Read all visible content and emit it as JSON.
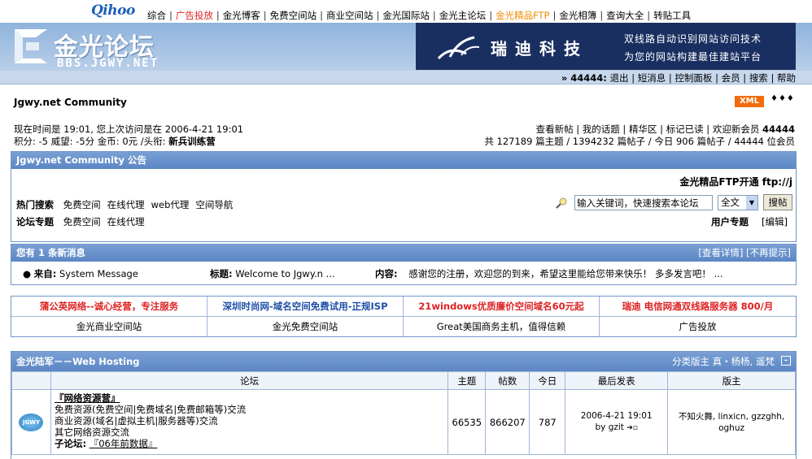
{
  "topnav": {
    "logo": "Qihoo",
    "links": [
      {
        "label": "综合",
        "color": "#000000"
      },
      {
        "label": "广告投放",
        "color": "#dd2222"
      },
      {
        "label": "金光博客",
        "color": "#000000"
      },
      {
        "label": "免费空间站",
        "color": "#000000"
      },
      {
        "label": "商业空间站",
        "color": "#000000"
      },
      {
        "label": "金光国际站",
        "color": "#000000"
      },
      {
        "label": "金光主论坛",
        "color": "#000000"
      },
      {
        "label": "金光精品FTP",
        "color": "#f08a00"
      },
      {
        "label": "金光相簿",
        "color": "#000000"
      },
      {
        "label": "查询大全",
        "color": "#000000"
      },
      {
        "label": "转贴工具",
        "color": "#000000"
      }
    ]
  },
  "header": {
    "logo_cn": "金光论坛",
    "logo_en": "BBS.JGWY.NET",
    "banner": {
      "name": "瑞迪科技",
      "line1": "双线路自动识别网站访问技术",
      "line2": "为您的网站构建最佳建站平台"
    }
  },
  "userbar": {
    "prefix": "» ",
    "user": "44444:",
    "links": [
      "退出",
      "短消息",
      "控制面板",
      "会员",
      "搜索",
      "帮助"
    ]
  },
  "main": {
    "community_title": "Jgwy.net Community",
    "xml_badge": "XML",
    "arrows": "♦♦♦",
    "status": {
      "time_line": "现在时间是 19:01, 您上次访问是在 2006-4-21 19:01",
      "stats_prefix": "积分: -5 威望: -5分 金币: 0元 /头衔: ",
      "rank": "新兵训练营",
      "right_links": "查看新帖 | 我的话题 | 精华区 | 标记已读 | 欢迎新会员 ",
      "newest_member": "44444",
      "totals": "共 127189 篇主题 / 1394232 篇帖子 / 今日 906 篇帖子 / 44444 位会员"
    },
    "notice": {
      "title": "Jgwy.net Community 公告",
      "marquee": "金光精品FTP开通 ftp://j",
      "hot_search_label": "热门搜索",
      "hot_search_links": [
        "免费空间",
        "在线代理",
        "web代理",
        "空间导航"
      ],
      "topics_label": "论坛专题",
      "topic_links": [
        "免费空间",
        "在线代理"
      ],
      "search_input": "输入关键词，快速搜索本论坛",
      "search_select": "全文",
      "search_button": "搜帖",
      "user_topics": "用户专题",
      "edit": "[编辑]"
    },
    "messages": {
      "title": "您有 1 条新消息",
      "view_detail": "[查看详情]",
      "no_remind": "[不再提示]",
      "from_label": "来自:",
      "from": "System Message",
      "subject_label": "标题:",
      "subject": "Welcome to Jgwy.n ...",
      "content_label": "内容:",
      "content": "感谢您的注册，欢迎您的到来，希望这里能给您带来快乐！ 多多发言吧！ ..."
    },
    "ads": {
      "row1": [
        {
          "text": "蒲公英网络--诚心经营，专注服务",
          "color": "#dd2222"
        },
        {
          "text": "深圳时尚网-域名空间免费试用-正规ISP",
          "color": "#1e4fa8"
        },
        {
          "text": "21windows优质廉价空间域名60元起",
          "color": "#dd2222"
        },
        {
          "text": "瑞迪 电信网通双线路服务器 800/月",
          "color": "#dd2222"
        }
      ],
      "row2": [
        "金光商业空间站",
        "金光免费空间站",
        "Great美国商务主机，值得信赖",
        "广告投放"
      ]
    },
    "forum": {
      "section_title": "金光陆军－－Web Hosting",
      "moderators": "分类版主 真・杨杨, 遥梵",
      "columns": [
        "论坛",
        "主题",
        "帖数",
        "今日",
        "最后发表",
        "版主"
      ],
      "rows": [
        {
          "icon_label": "JGWY",
          "name": "『网络资源营』",
          "desc_lines": [
            "免费资源(免费空间|免费域名|免费邮箱等)交流",
            "商业资源(域名|虚拟主机|服务器等)交流",
            "其它网络资源交流"
          ],
          "sub_label": "子论坛:",
          "sub": "『06年前数据』",
          "topics": "66535",
          "posts": "866207",
          "today": "787",
          "last_time": "2006-4-21 19:01",
          "last_by": "by gzit",
          "mods": "不知火舞, linxicn, gzzghh, oghuz"
        }
      ]
    }
  }
}
